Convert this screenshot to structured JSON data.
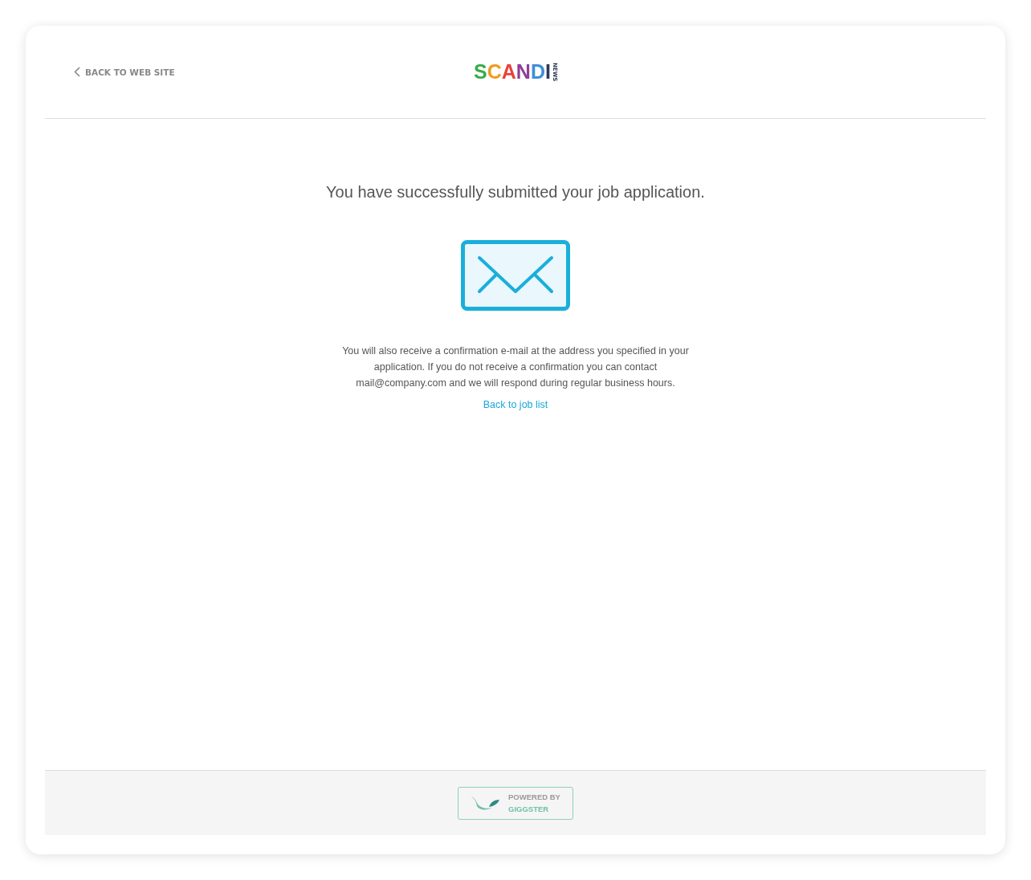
{
  "header": {
    "back_link": "BACK TO WEB SITE",
    "logo": {
      "letters": [
        {
          "text": "S",
          "color": "#3aaa4a"
        },
        {
          "text": "C",
          "color": "#f39a1e"
        },
        {
          "text": "A",
          "color": "#e8433c"
        },
        {
          "text": "N",
          "color": "#8e3f97"
        },
        {
          "text": "D",
          "color": "#3f8fd6"
        },
        {
          "text": "I",
          "color": "#2b3a55"
        }
      ],
      "tag": "NEWS"
    }
  },
  "main": {
    "heading": "You have successfully submitted your job application.",
    "message": "You will also receive a confirmation e-mail at the address you specified in your application. If you do not receive a confirmation you can contact mail@company.com and we will respond during regular business hours.",
    "link": "Back to job list"
  },
  "footer": {
    "badge_top": "POWERED BY",
    "badge_bottom": "GIGGSTER"
  }
}
